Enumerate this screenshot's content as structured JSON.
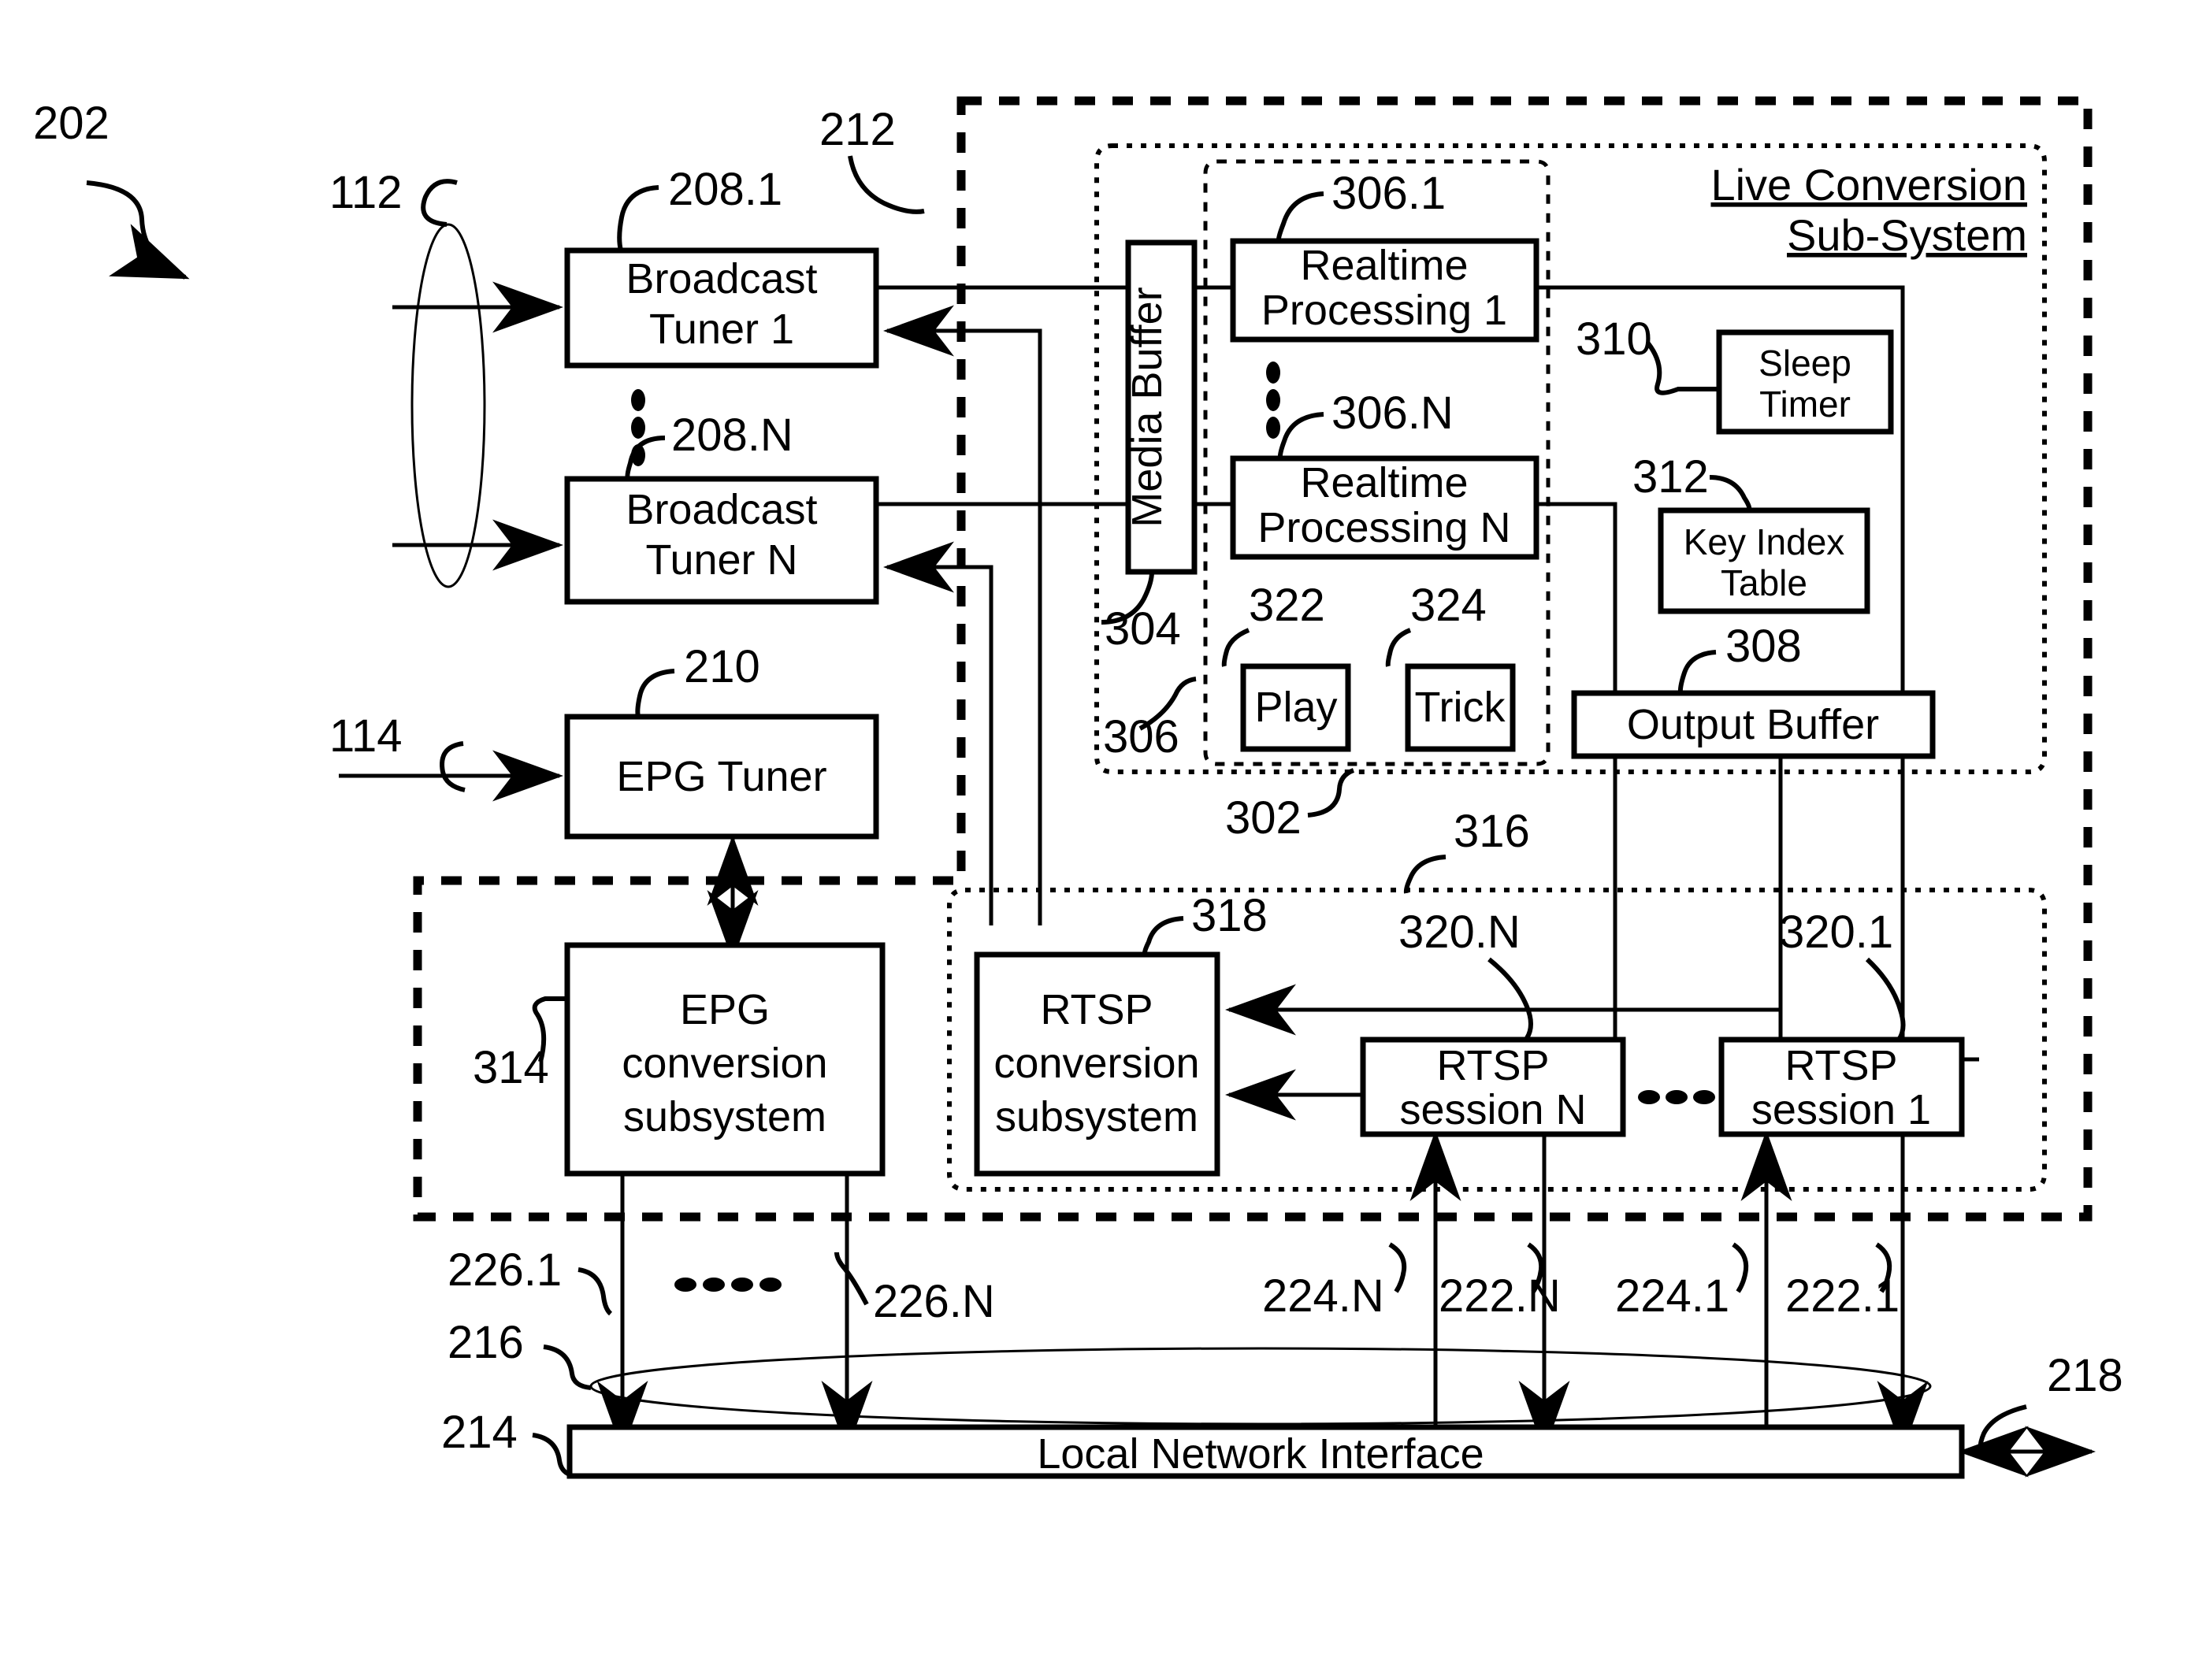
{
  "figure": {
    "type": "patent-block-diagram",
    "overall_ref": "202"
  },
  "reference_numerals": {
    "overall": "202",
    "broadcast_input": "112",
    "epg_input": "114",
    "tuner_1": "208.1",
    "tuner_n": "208.N",
    "epg_tuner": "210",
    "outer_subsystem": "212",
    "local_network_interface": "214",
    "network_cloud": "216",
    "external_network": "218",
    "stream_222_1": "222.1",
    "stream_222_n": "222.N",
    "stream_224_1": "224.1",
    "stream_224_n": "224.N",
    "epg_stream_1": "226.1",
    "epg_stream_n": "226.N",
    "live_conversion_inner": "302",
    "media_buffer": "304",
    "realtime_group": "306",
    "realtime_1": "306.1",
    "realtime_n": "306.N",
    "output_buffer": "308",
    "sleep_timer": "310",
    "key_index_table": "312",
    "epg_conversion_subsystem": "314",
    "rtsp_group": "316",
    "rtsp_conversion_subsystem": "318",
    "rtsp_session_1": "320.1",
    "rtsp_session_n": "320.N",
    "play": "322",
    "trick": "324"
  },
  "blocks": {
    "broadcast_tuner_1": {
      "line1": "Broadcast",
      "line2": "Tuner 1"
    },
    "broadcast_tuner_n": {
      "line1": "Broadcast",
      "line2": "Tuner N"
    },
    "epg_tuner": {
      "line1": "EPG Tuner"
    },
    "media_buffer": {
      "line1": "Media Buffer"
    },
    "realtime_processing_1": {
      "line1": "Realtime",
      "line2": "Processing 1"
    },
    "realtime_processing_n": {
      "line1": "Realtime",
      "line2": "Processing N"
    },
    "sleep_timer": {
      "line1": "Sleep",
      "line2": "Timer"
    },
    "key_index_table": {
      "line1": "Key Index",
      "line2": "Table"
    },
    "play": {
      "line1": "Play"
    },
    "trick": {
      "line1": "Trick"
    },
    "output_buffer": {
      "line1": "Output Buffer"
    },
    "epg_conversion_subsystem": {
      "line1": "EPG",
      "line2": "conversion",
      "line3": "subsystem"
    },
    "rtsp_conversion_subsystem": {
      "line1": "RTSP",
      "line2": "conversion",
      "line3": "subsystem"
    },
    "rtsp_session_n": {
      "line1": "RTSP",
      "line2": "session N"
    },
    "rtsp_session_1": {
      "line1": "RTSP",
      "line2": "session 1"
    },
    "local_network_interface": {
      "line1": "Local Network Interface"
    }
  },
  "group_titles": {
    "live_conversion_line1": "Live Conversion",
    "live_conversion_line2": "Sub-System"
  },
  "colors": {
    "ink": "#000000",
    "paper": "#ffffff"
  }
}
